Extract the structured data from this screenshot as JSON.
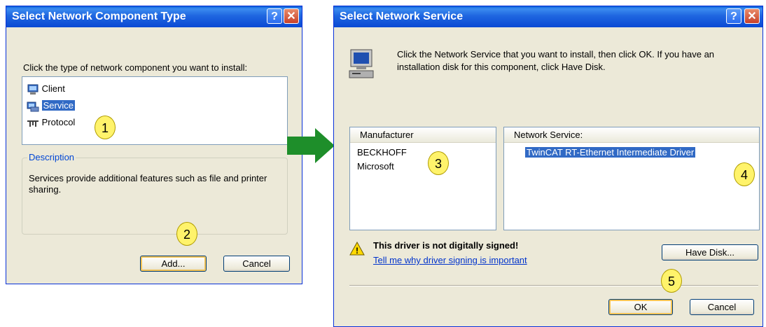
{
  "dialog1": {
    "title": "Select Network Component Type",
    "help_glyph": "?",
    "close_glyph": "✕",
    "instruction": "Click the type of network component you want to install:",
    "items": [
      "Client",
      "Service",
      "Protocol"
    ],
    "description_label": "Description",
    "description_text": "Services provide additional features such as file and printer sharing.",
    "add_label": "Add...",
    "cancel_label": "Cancel"
  },
  "dialog2": {
    "title": "Select Network Service",
    "help_glyph": "?",
    "close_glyph": "✕",
    "instruction": "Click the Network Service that you want to install, then click OK. If you have an installation disk for this component, click Have Disk.",
    "manufacturer_header": "Manufacturer",
    "manufacturers": [
      "BECKHOFF",
      "Microsoft"
    ],
    "service_header": "Network Service:",
    "services": [
      "TwinCAT RT-Ethernet Intermediate Driver"
    ],
    "warning_title": "This driver is not digitally signed!",
    "warning_link": "Tell me why driver signing is important",
    "have_disk_label": "Have Disk...",
    "ok_label": "OK",
    "cancel_label": "Cancel"
  },
  "callouts": [
    "1",
    "2",
    "3",
    "4",
    "5"
  ],
  "icons": {
    "client": "client-icon",
    "service": "service-icon",
    "protocol": "protocol-icon",
    "computer": "computer-icon",
    "warning": "warning-icon",
    "arrow": "green-arrow-icon"
  },
  "colors": {
    "titlebar": "#0a49d4",
    "selection": "#316ac5",
    "callout": "#fff36b",
    "arrow": "#1e8e2a"
  }
}
